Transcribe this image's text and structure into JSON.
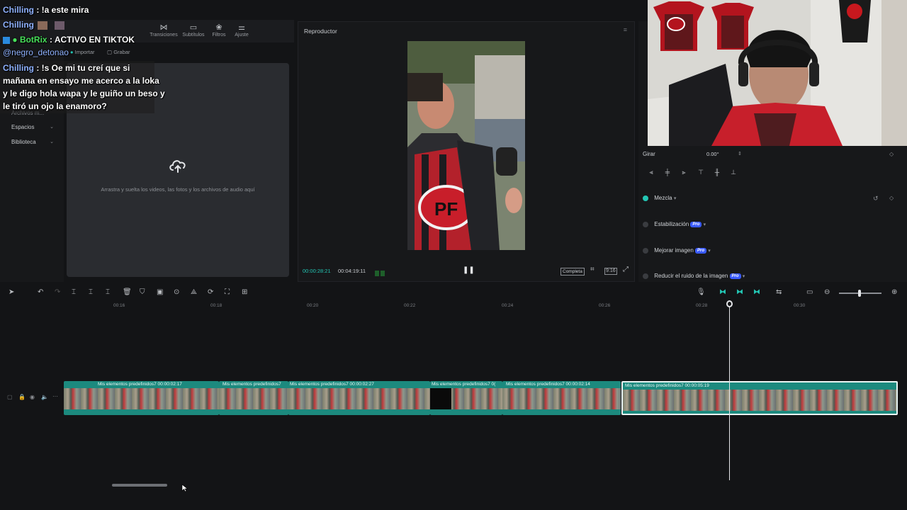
{
  "chat": {
    "line1_user": "Chilling",
    "line1_text": ": !a este mira",
    "line2_user": "Chilling",
    "line3_bot": "BotRix",
    "line3_text": ": ACTIVO EN TIKTOK",
    "line4_mention": "@negro_detonao",
    "line5_user": "Chilling",
    "line5_text": ": !s Oe mi tu creí que si",
    "line6_text": "mañana en ensayo me acerco a la loka",
    "line7_text": "y le digo hola wapa y le guiño un beso y",
    "line8_text": "le tiró un ojo la enamoro?"
  },
  "media_toolbar": {
    "tabs": [
      {
        "label": "Transiciones",
        "icon": "transitions-icon"
      },
      {
        "label": "Subtítulos",
        "icon": "subtitles-icon"
      },
      {
        "label": "Filtros",
        "icon": "filters-icon"
      },
      {
        "label": "Ajuste",
        "icon": "adjust-icon"
      }
    ],
    "import_label": "Importar",
    "record_label": "Grabar"
  },
  "left_panel": {
    "items": [
      {
        "label": "Archivos m..."
      },
      {
        "label": "Espacios"
      },
      {
        "label": "Biblioteca"
      }
    ]
  },
  "drop_zone": {
    "text": "Arrastra y suelta los videos, las fotos y los archivos de audio aquí"
  },
  "player": {
    "title": "Reproductor",
    "time_current": "00:00:28:21",
    "time_total": "00:04:19:11",
    "quality": "Completa",
    "ratio": "9:16"
  },
  "inspector": {
    "rotate_label": "Girar",
    "rotate_value": "0.00°",
    "blend_label": "Mezcla",
    "stabilization_label": "Estabilización",
    "enhance_label": "Mejorar imagen",
    "denoise_label": "Reducir el ruido de la imagen",
    "pro_badge": "Pro"
  },
  "timeline": {
    "ruler_ticks": [
      "00:16",
      "00:18",
      "00:20",
      "00:22",
      "00:24",
      "00:26",
      "00:28",
      "00:30"
    ],
    "clips": [
      {
        "label": "Mis elementos predefinidos7  00:00:02:17",
        "selected": false
      },
      {
        "label": "Mis elementos predefinidos7",
        "selected": false
      },
      {
        "label": "Mis elementos predefinidos7  00:00:02:27",
        "selected": false
      },
      {
        "label": "Mis elementos predefinidos7  0(",
        "selected": false
      },
      {
        "label": "Mis elementos predefinidos7  00:00:02:14",
        "selected": false
      },
      {
        "label": "Mis elementos predefinidos7  00:00:05:19",
        "selected": true
      }
    ]
  }
}
